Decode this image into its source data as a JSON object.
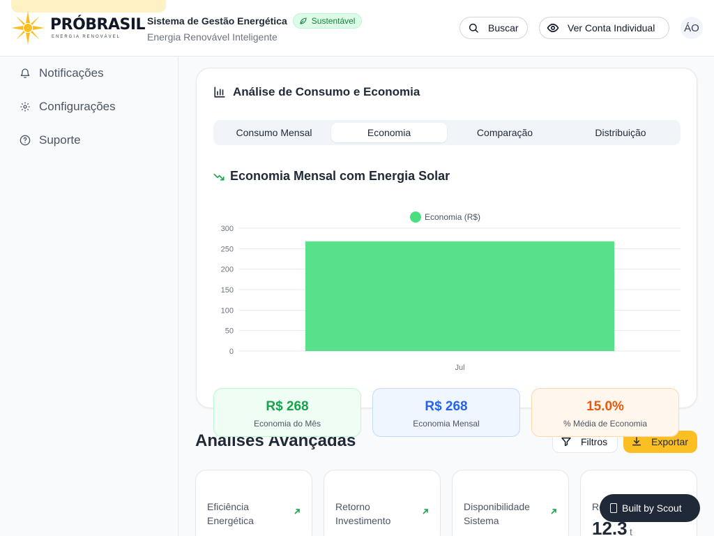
{
  "header": {
    "logo": {
      "word": "PRÓBRASIL",
      "sub": "ENERGIA RENOVÁVEL"
    },
    "title": "Sistema de Gestão Energética",
    "badge": "Sustentável",
    "subtitle": "Energia Renovável Inteligente",
    "search_label": "Buscar",
    "view_label": "Ver Conta Individual",
    "avatar": "ÁO"
  },
  "sidebar": {
    "items": [
      {
        "label": "Notificações",
        "icon": "bell-icon"
      },
      {
        "label": "Configurações",
        "icon": "gear-icon"
      },
      {
        "label": "Suporte",
        "icon": "help-circle-icon"
      }
    ]
  },
  "analysis": {
    "title": "Análise de Consumo e Economia",
    "tabs": [
      "Consumo Mensal",
      "Economia",
      "Comparação",
      "Distribuição"
    ],
    "active_tab": 1,
    "section_title": "Economia Mensal com Energia Solar"
  },
  "chart_data": {
    "type": "bar",
    "categories": [
      "Jul"
    ],
    "series": [
      {
        "name": "Economia (R$)",
        "values": [
          268
        ],
        "color": "#4ade80"
      }
    ],
    "ylim": [
      0,
      300
    ],
    "yticks": [
      0,
      50,
      100,
      150,
      200,
      250,
      300
    ],
    "legend": "top-center",
    "grid": true
  },
  "stats": [
    {
      "value": "R$ 268",
      "label": "Economia do Mês"
    },
    {
      "value": "R$ 268",
      "label": "Economia Mensal"
    },
    {
      "value": "15.0%",
      "label": "% Média de Economia"
    }
  ],
  "advanced": {
    "title": "Análises Avançadas",
    "filter_label": "Filtros",
    "export_label": "Exportar",
    "cards": [
      {
        "label": "Eficiência Energética"
      },
      {
        "label": "Retorno Investimento"
      },
      {
        "label": "Disponibilidade Sistema"
      },
      {
        "label": "Re",
        "value": "12.3",
        "unit": "t"
      }
    ]
  },
  "built_by": "Built by Scout"
}
